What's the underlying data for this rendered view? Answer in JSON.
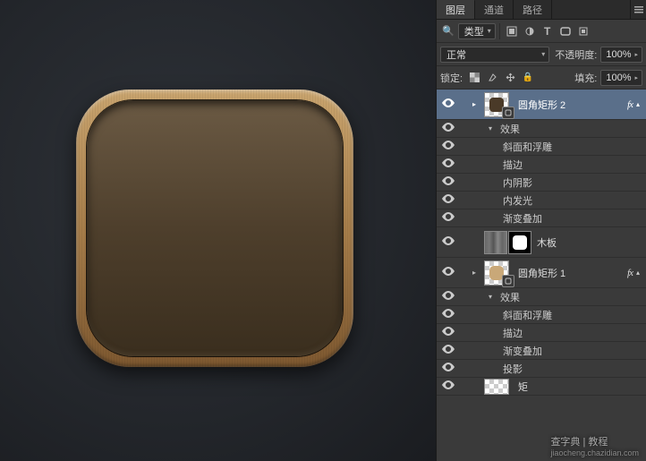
{
  "tabs": {
    "layers": "图层",
    "channels": "通道",
    "paths": "路径"
  },
  "filter": {
    "kind": "类型"
  },
  "blend": {
    "mode": "正常",
    "opacity_label": "不透明度:",
    "opacity_value": "100%",
    "lock_label": "锁定:",
    "fill_label": "填充:",
    "fill_value": "100%"
  },
  "layers": {
    "shape2": "圆角矩形 2",
    "effects": "效果",
    "fx_bevel": "斜面和浮雕",
    "fx_stroke": "描边",
    "fx_inner_shadow": "内阴影",
    "fx_inner_glow": "内发光",
    "fx_gradient": "渐变叠加",
    "wood": "木板",
    "shape1": "圆角矩形 1",
    "fx_drop_shadow": "投影",
    "bg_frag": "矩"
  },
  "watermark": {
    "main": "查字典 | 教程",
    "sub": "jiaocheng.chazidian.com"
  }
}
